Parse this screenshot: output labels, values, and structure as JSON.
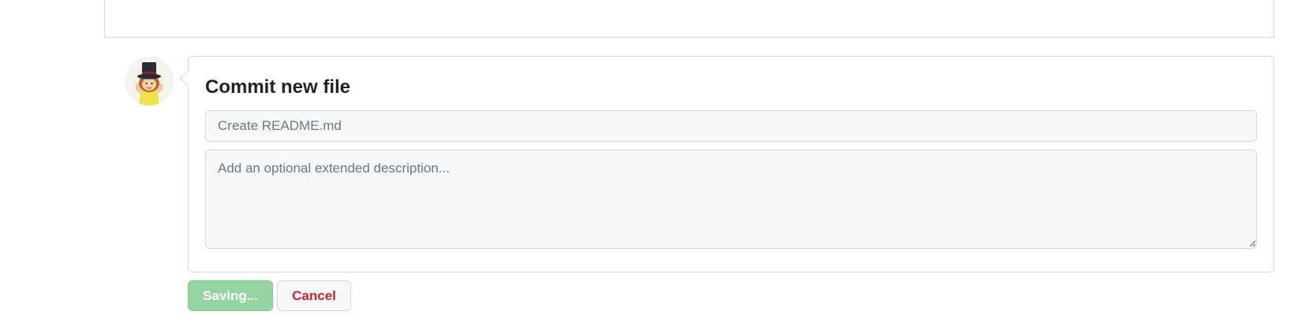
{
  "commit": {
    "title": "Commit new file",
    "summary_placeholder": "Create README.md",
    "summary_value": "",
    "description_placeholder": "Add an optional extended description...",
    "description_value": ""
  },
  "actions": {
    "submit_label": "Saving...",
    "cancel_label": "Cancel"
  },
  "colors": {
    "submit_bg": "#94d3a2",
    "cancel_text": "#cf222e",
    "border": "#d0d7de",
    "input_bg": "#f6f8fa"
  },
  "icons": {
    "avatar": "user-avatar",
    "resize": "resize-handle-icon"
  }
}
